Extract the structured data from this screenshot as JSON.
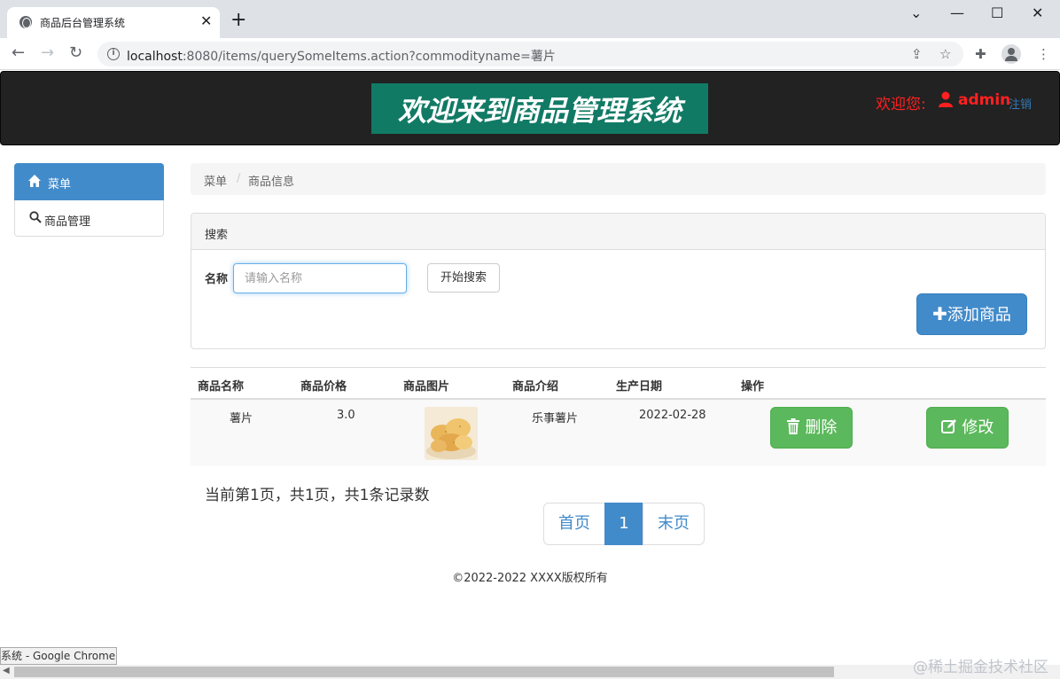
{
  "browser": {
    "tab_title": "商品后台管理系统",
    "tab_close": "✕",
    "new_tab": "+",
    "url_host": "localhost",
    "url_rest": ":8080/items/querySomeItems.action?commodityname=薯片",
    "window_controls": {
      "minimize": "—",
      "maximize": "☐",
      "close": "✕"
    }
  },
  "header": {
    "banner": "欢迎来到商品管理系统",
    "welcome": "欢迎您:",
    "username": "admin",
    "logout": "注销",
    "welcome_color": "#ff2020",
    "banner_bg": "#117a65"
  },
  "sidebar": {
    "items": [
      {
        "label": "菜单",
        "icon": "home-icon",
        "active": true
      },
      {
        "label": "商品管理",
        "icon": "search-icon",
        "active": false
      }
    ],
    "accent": "#428bca"
  },
  "breadcrumb": {
    "items": [
      "菜单",
      "商品信息"
    ],
    "separator": "/"
  },
  "search_panel": {
    "title": "搜索",
    "name_label": "名称",
    "input_placeholder": "请输入名称",
    "input_value": "",
    "search_button": "开始搜索",
    "add_button": "添加商品"
  },
  "table": {
    "columns": [
      "商品名称",
      "商品价格",
      "商品图片",
      "商品介绍",
      "生产日期",
      "操作"
    ],
    "rows": [
      {
        "name": "薯片",
        "price": "3.0",
        "image": "potato-chips-thumbnail",
        "description": "乐事薯片",
        "date": "2022-02-28",
        "delete_label": "删除",
        "edit_label": "修改"
      }
    ]
  },
  "pagination": {
    "info": "当前第1页，共1页，共1条记录数",
    "first": "首页",
    "current": "1",
    "last": "末页"
  },
  "footer": {
    "copyright": "©2022-2022 XXXX版权所有"
  },
  "status_tooltip": "系统 - Google Chrome",
  "watermark": "@稀土掘金技术社区"
}
